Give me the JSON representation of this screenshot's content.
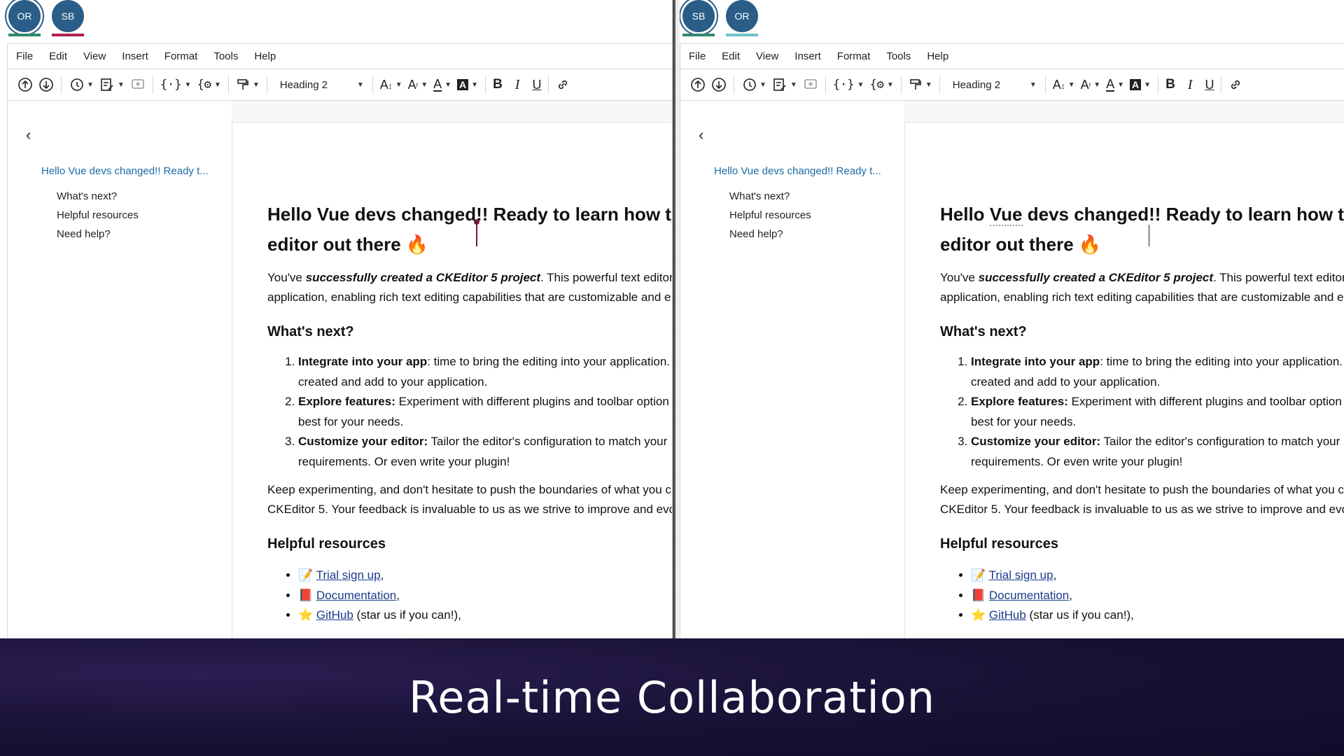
{
  "menu": [
    "File",
    "Edit",
    "View",
    "Insert",
    "Format",
    "Tools",
    "Help"
  ],
  "toolbar": {
    "heading_select": "Heading 2"
  },
  "colors": {
    "avatar_blue": "#2a5d87",
    "avatar_blue_dark": "#1f4f78",
    "user_or_bar": "#2e8a6c",
    "user_sb_bar": "#b0214d",
    "user_or_bar_right": "#6fc3c9",
    "link": "#1a3a8c",
    "outline_active": "#1b6ba6"
  },
  "left_pane": {
    "avatars": [
      {
        "initials": "OR",
        "bar": "#2e8a6c"
      },
      {
        "initials": "SB",
        "bar": "#b0214d"
      }
    ]
  },
  "right_pane": {
    "avatars": [
      {
        "initials": "SB",
        "bar": "#2e8a6c"
      },
      {
        "initials": "OR",
        "bar": "#6fc3c9"
      }
    ]
  },
  "outline": {
    "title": "Hello Vue devs changed!! Ready t...",
    "items": [
      "What's next?",
      "Helpful resources",
      "Need help?"
    ]
  },
  "doc": {
    "heading_part1": "Hello ",
    "heading_vue": "Vue",
    "heading_part2": " devs changed",
    "heading_part3": "!! Ready to learn how to w",
    "heading_line2": "editor out there 🔥",
    "p1_line1_pre": "You've ",
    "p1_line1_em": "successfully created a CKEditor 5 project",
    "p1_line1_post": ". This powerful text editor will",
    "p1_line1_post_right": ". This powerful text editor will",
    "p1_line2": "application, enabling rich text editing capabilities that are customizable and e",
    "whats_next": "What's next?",
    "list": [
      {
        "bold": "Integrate into your app",
        "text": ": time to bring the editing into your application.",
        "cont": "created and add to your application."
      },
      {
        "bold": "Explore features:",
        "text": " Experiment with different plugins and toolbar option",
        "cont": "best for your needs."
      },
      {
        "bold": "Customize your editor:",
        "text": " Tailor the editor's configuration to match your",
        "cont": "requirements. Or even write your plugin!"
      }
    ],
    "p2_line1": "Keep experimenting, and don't hesitate to push the boundaries of what you c",
    "p2_line2": "CKEditor 5. Your feedback is invaluable to us as we strive to improve and evo",
    "helpful_resources": "Helpful resources",
    "resources": [
      {
        "emoji": "📝",
        "link": "Trial sign up",
        "tail": ","
      },
      {
        "emoji": "📕",
        "link": "Documentation",
        "tail": ","
      },
      {
        "emoji": "⭐️",
        "link": "GitHub",
        "tail": " (star us if you can!),"
      }
    ]
  },
  "banner": {
    "text": "Real-time Collaboration"
  }
}
